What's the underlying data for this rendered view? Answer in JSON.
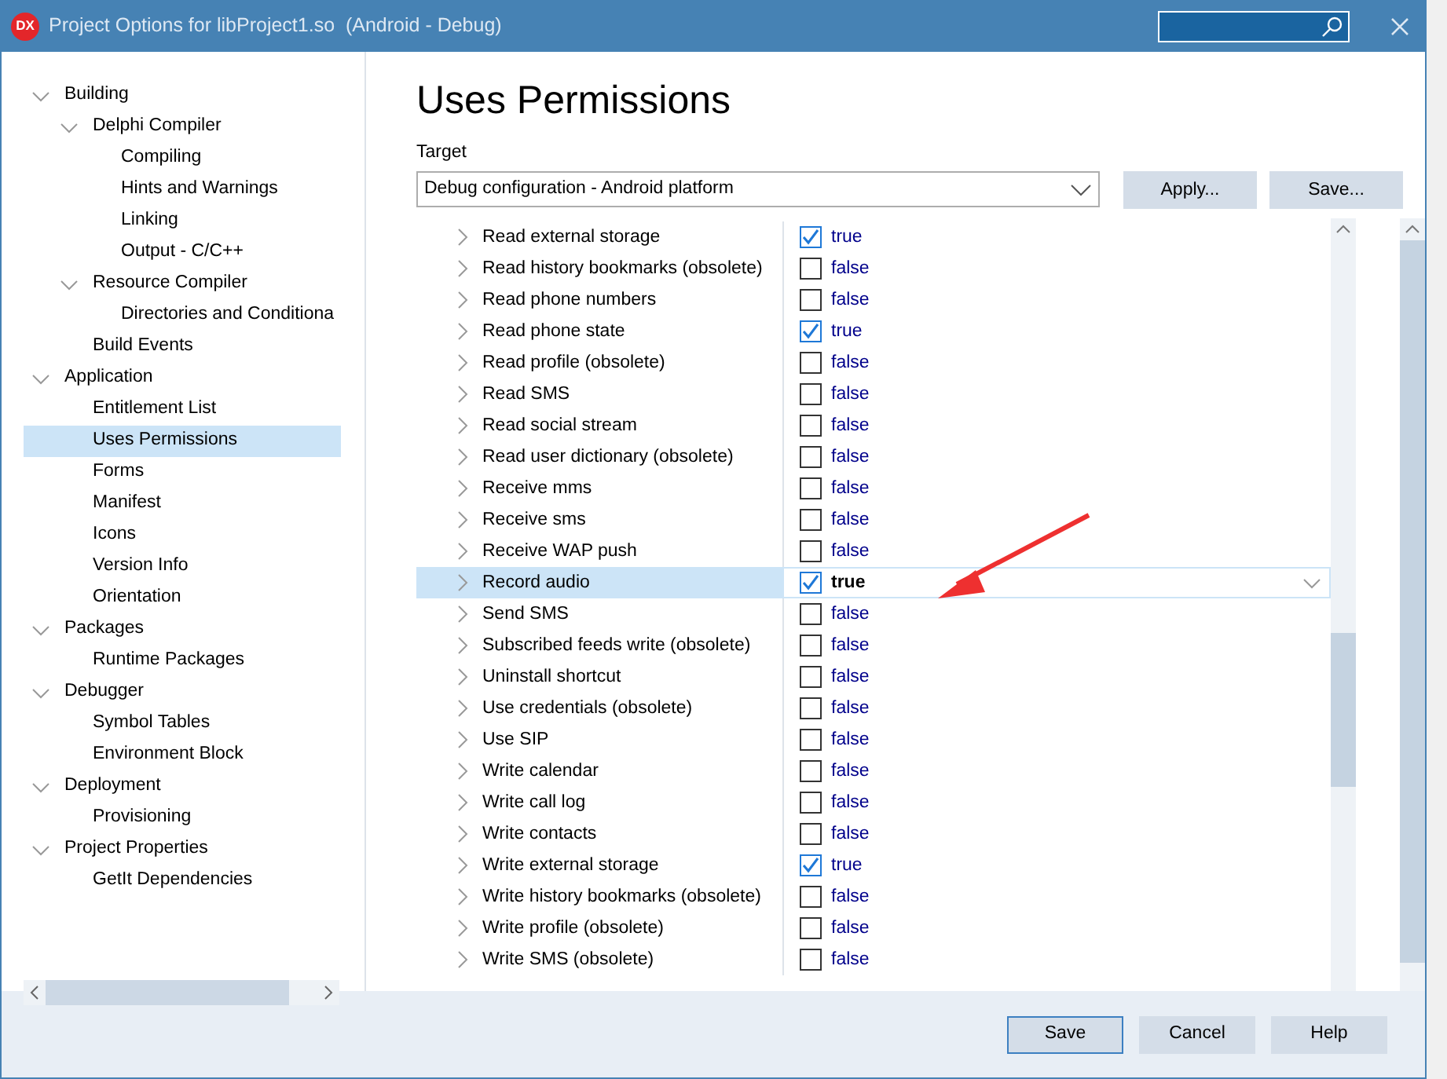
{
  "window": {
    "title": "Project Options for libProject1.so  (Android - Debug)",
    "logo": "DX"
  },
  "tree": [
    {
      "label": "Building",
      "expanded": true,
      "selected": false,
      "children": [
        {
          "label": "Delphi Compiler",
          "expanded": true,
          "selected": false,
          "children": [
            {
              "label": "Compiling",
              "selected": false
            },
            {
              "label": "Hints and Warnings",
              "selected": false
            },
            {
              "label": "Linking",
              "selected": false
            },
            {
              "label": "Output - C/C++",
              "selected": false
            }
          ]
        },
        {
          "label": "Resource Compiler",
          "expanded": true,
          "selected": false,
          "children": [
            {
              "label": "Directories and Conditiona",
              "selected": false
            }
          ]
        },
        {
          "label": "Build Events",
          "selected": false
        }
      ]
    },
    {
      "label": "Application",
      "expanded": true,
      "selected": false,
      "children": [
        {
          "label": "Entitlement List",
          "selected": false
        },
        {
          "label": "Uses Permissions",
          "selected": true
        },
        {
          "label": "Forms",
          "selected": false
        },
        {
          "label": "Manifest",
          "selected": false
        },
        {
          "label": "Icons",
          "selected": false
        },
        {
          "label": "Version Info",
          "selected": false
        },
        {
          "label": "Orientation",
          "selected": false
        }
      ]
    },
    {
      "label": "Packages",
      "expanded": true,
      "selected": false,
      "children": [
        {
          "label": "Runtime Packages",
          "selected": false
        }
      ]
    },
    {
      "label": "Debugger",
      "expanded": true,
      "selected": false,
      "children": [
        {
          "label": "Symbol Tables",
          "selected": false
        },
        {
          "label": "Environment Block",
          "selected": false
        }
      ]
    },
    {
      "label": "Deployment",
      "expanded": true,
      "selected": false,
      "children": [
        {
          "label": "Provisioning",
          "selected": false
        }
      ]
    },
    {
      "label": "Project Properties",
      "expanded": true,
      "selected": false,
      "children": [
        {
          "label": "GetIt Dependencies",
          "selected": false
        }
      ]
    }
  ],
  "page": {
    "heading": "Uses Permissions",
    "target_label": "Target",
    "target_value": "Debug configuration - Android platform",
    "buttons": [
      "Apply...",
      "Save..."
    ]
  },
  "permissions": [
    {
      "name": "Read external storage",
      "checked": true,
      "value": "true",
      "selected": false
    },
    {
      "name": "Read history bookmarks (obsolete)",
      "checked": false,
      "value": "false",
      "selected": false
    },
    {
      "name": "Read phone numbers",
      "checked": false,
      "value": "false",
      "selected": false
    },
    {
      "name": "Read phone state",
      "checked": true,
      "value": "true",
      "selected": false
    },
    {
      "name": "Read profile (obsolete)",
      "checked": false,
      "value": "false",
      "selected": false
    },
    {
      "name": "Read SMS",
      "checked": false,
      "value": "false",
      "selected": false
    },
    {
      "name": "Read social stream",
      "checked": false,
      "value": "false",
      "selected": false
    },
    {
      "name": "Read user dictionary (obsolete)",
      "checked": false,
      "value": "false",
      "selected": false
    },
    {
      "name": "Receive mms",
      "checked": false,
      "value": "false",
      "selected": false
    },
    {
      "name": "Receive sms",
      "checked": false,
      "value": "false",
      "selected": false
    },
    {
      "name": "Receive WAP push",
      "checked": false,
      "value": "false",
      "selected": false
    },
    {
      "name": "Record audio",
      "checked": true,
      "value": "true",
      "selected": true
    },
    {
      "name": "Send SMS",
      "checked": false,
      "value": "false",
      "selected": false
    },
    {
      "name": "Subscribed feeds write (obsolete)",
      "checked": false,
      "value": "false",
      "selected": false
    },
    {
      "name": "Uninstall shortcut",
      "checked": false,
      "value": "false",
      "selected": false
    },
    {
      "name": "Use credentials (obsolete)",
      "checked": false,
      "value": "false",
      "selected": false
    },
    {
      "name": "Use SIP",
      "checked": false,
      "value": "false",
      "selected": false
    },
    {
      "name": "Write calendar",
      "checked": false,
      "value": "false",
      "selected": false
    },
    {
      "name": "Write call log",
      "checked": false,
      "value": "false",
      "selected": false
    },
    {
      "name": "Write contacts",
      "checked": false,
      "value": "false",
      "selected": false
    },
    {
      "name": "Write external storage",
      "checked": true,
      "value": "true",
      "selected": false
    },
    {
      "name": "Write history bookmarks (obsolete)",
      "checked": false,
      "value": "false",
      "selected": false
    },
    {
      "name": "Write profile (obsolete)",
      "checked": false,
      "value": "false",
      "selected": false
    },
    {
      "name": "Write SMS (obsolete)",
      "checked": false,
      "value": "false",
      "selected": false
    }
  ],
  "footer_buttons": [
    {
      "label": "Save",
      "default": true
    },
    {
      "label": "Cancel",
      "default": false
    },
    {
      "label": "Help",
      "default": false
    }
  ]
}
